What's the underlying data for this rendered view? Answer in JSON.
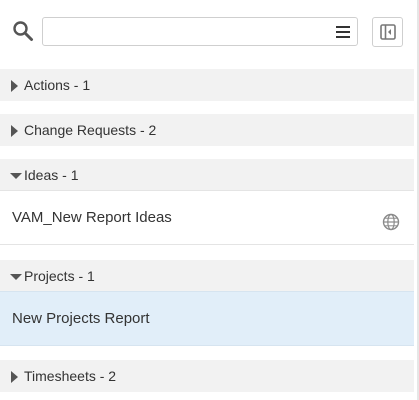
{
  "search": {
    "placeholder": "",
    "value": ""
  },
  "groups": [
    {
      "label": "Actions - 1",
      "expanded": false
    },
    {
      "label": "Change Requests - 2",
      "expanded": false
    },
    {
      "label": "Ideas - 1",
      "expanded": true,
      "items": [
        {
          "label": "VAM_New Report Ideas",
          "icon": "globe-icon",
          "selected": false
        }
      ]
    },
    {
      "label": "Projects - 1",
      "expanded": true,
      "items": [
        {
          "label": "New Projects Report",
          "selected": true
        }
      ]
    },
    {
      "label": "Timesheets - 2",
      "expanded": false
    }
  ],
  "colors": {
    "group_header_bg": "#f2f2f2",
    "selected_item_bg": "#e1eef9",
    "icon_gray": "#6b6b6b"
  }
}
